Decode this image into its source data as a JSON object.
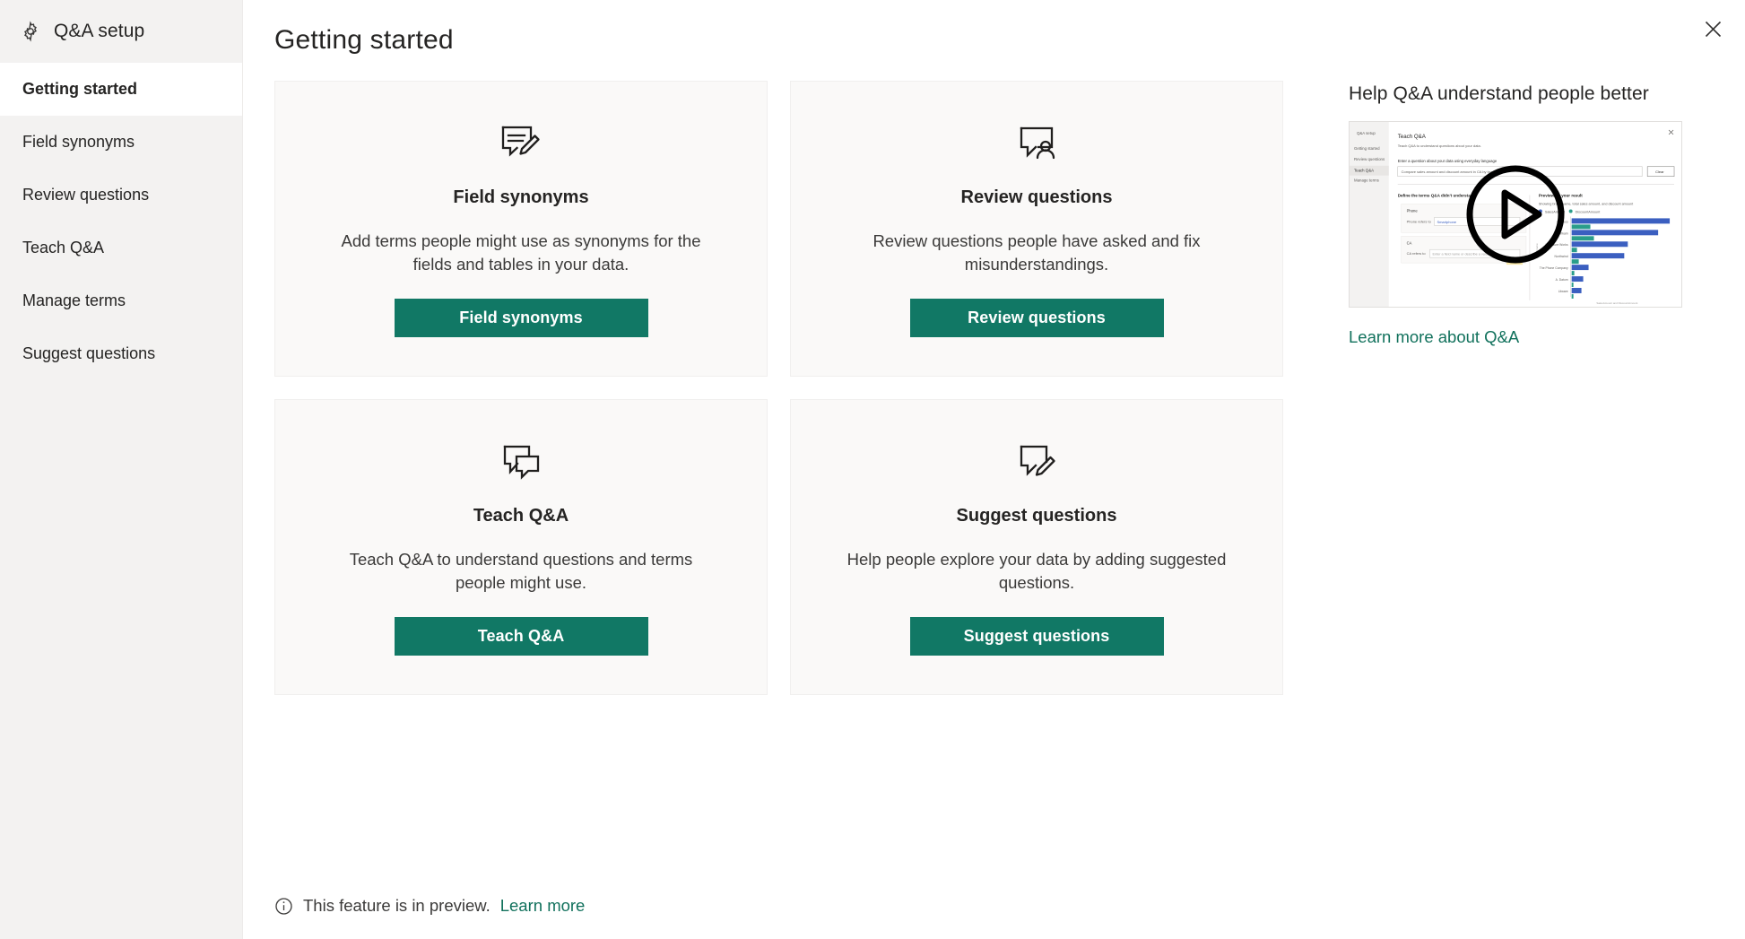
{
  "colors": {
    "accent_teal": "#117865",
    "link_teal": "#11715c",
    "sidebar_bg": "#f3f2f1",
    "card_bg": "#faf9f8",
    "text": "#252423"
  },
  "sidebar": {
    "app_title": "Q&A setup",
    "gear_icon": "gear-icon",
    "items": [
      {
        "label": "Getting started",
        "active": true
      },
      {
        "label": "Field synonyms",
        "active": false
      },
      {
        "label": "Review questions",
        "active": false
      },
      {
        "label": "Teach Q&A",
        "active": false
      },
      {
        "label": "Manage terms",
        "active": false
      },
      {
        "label": "Suggest questions",
        "active": false
      }
    ]
  },
  "header": {
    "title": "Getting started",
    "close_icon": "close-icon"
  },
  "cards": [
    {
      "icon": "note-pencil-icon",
      "title": "Field synonyms",
      "description": "Add terms people might use as synonyms for the fields and tables in your data.",
      "button_label": "Field synonyms"
    },
    {
      "icon": "speech-bubble-person-icon",
      "title": "Review questions",
      "description": "Review questions people have asked and fix misunderstandings.",
      "button_label": "Review questions"
    },
    {
      "icon": "two-speech-bubbles-icon",
      "title": "Teach Q&A",
      "description": "Teach Q&A to understand questions and terms people might use.",
      "button_label": "Teach Q&A"
    },
    {
      "icon": "speech-bubble-pencil-icon",
      "title": "Suggest questions",
      "description": "Help people explore your data by adding suggested questions.",
      "button_label": "Suggest questions"
    }
  ],
  "help_panel": {
    "title": "Help Q&A understand people better",
    "video_play_icon": "play-icon",
    "video_preview": {
      "sidebar_title": "Q&A setup",
      "sidebar_items": [
        "Getting started",
        "Review questions",
        "Teach Q&A",
        "Manage terms"
      ],
      "heading": "Teach Q&A",
      "subheading": "Teach Q&A to understand questions about your data.",
      "field_label": "Enter a question about your data using everyday language",
      "field_value": "Compare sales amount and discount amount in CA by brand",
      "clear_button": "Clear",
      "define_label": "Define the terms Q&A didn't understand",
      "term_1_name": "Phone",
      "term_1_prefix": "Phone refers to",
      "term_1_value": "Smartphone",
      "term_2_name": "CA",
      "term_2_prefix": "CA refers to",
      "term_2_placeholder": "Enter a field name or describe a value in your data",
      "result_heading": "Previewing your result",
      "result_sub": "Showing brand name, total sales amount, and discount amount",
      "legend": [
        "SalesAmount",
        "DiscountAmount"
      ],
      "axis_label": "brand name",
      "footer_label": "SalesAmount and DiscountAmount",
      "chart": {
        "type": "bar",
        "categories": [
          "Contoso",
          "Fabrikam",
          "Adventure Works",
          "Northwind",
          "The Phone Company",
          "A. Datum",
          "Litware"
        ],
        "series": [
          {
            "name": "SalesAmount",
            "color": "#3b5fc0",
            "values": [
              100,
              88,
              57,
              54,
              17,
              12,
              10
            ]
          },
          {
            "name": "DiscountAmount",
            "color": "#2a9d8a",
            "values": [
              19,
              23,
              5,
              7,
              3,
              2,
              2
            ]
          }
        ]
      }
    },
    "learn_more_label": "Learn more about Q&A"
  },
  "footer": {
    "info_icon": "info-circle-icon",
    "text": "This feature is in preview.",
    "link_label": "Learn more"
  }
}
